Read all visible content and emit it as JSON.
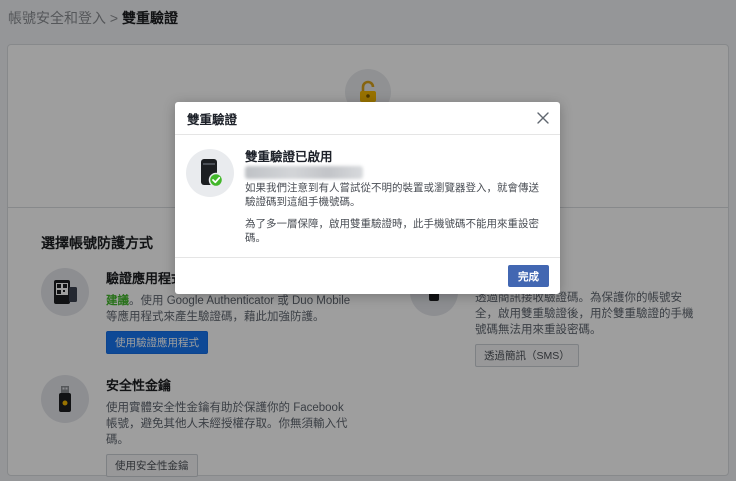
{
  "breadcrumb": {
    "parent": "帳號安全和登入",
    "separator": ">",
    "current": "雙重驗證"
  },
  "section": {
    "title": "選擇帳號防護方式"
  },
  "methods": {
    "auth_app": {
      "title": "驗證應用程式",
      "recommended": "建議",
      "description": "。使用 Google Authenticator 或 Duo Mobile 等應用程式來產生驗證碼，藉此加強防護。",
      "button": "使用驗證應用程式"
    },
    "sms": {
      "description": "透過簡訊接收驗證碼。為保護你的帳號安全，啟用雙重驗證後，用於雙重驗證的手機號碼無法用來重設密碼。",
      "button": "透過簡訊（SMS）"
    },
    "security_key": {
      "title": "安全性金鑰",
      "description": "使用實體安全性金鑰有助於保護你的 Facebook 帳號，避免其他人未經授權存取。你無須輸入代碼。",
      "button": "使用安全性金鑰"
    }
  },
  "modal": {
    "title": "雙重驗證",
    "heading": "雙重驗證已啟用",
    "paragraph1": "如果我們注意到有人嘗試從不明的裝置或瀏覽器登入，就會傳送驗證碼到這組手機號碼。",
    "paragraph2": "為了多一層保障，啟用雙重驗證時，此手機號碼不能用來重設密碼。",
    "done_button": "完成"
  },
  "colors": {
    "primary": "#4267b2",
    "facebook_blue": "#1877f2",
    "success": "#42b72a"
  },
  "icons": [
    "lock-icon",
    "qr-phone-icon",
    "usb-key-icon",
    "phone-check-icon",
    "close-icon"
  ]
}
